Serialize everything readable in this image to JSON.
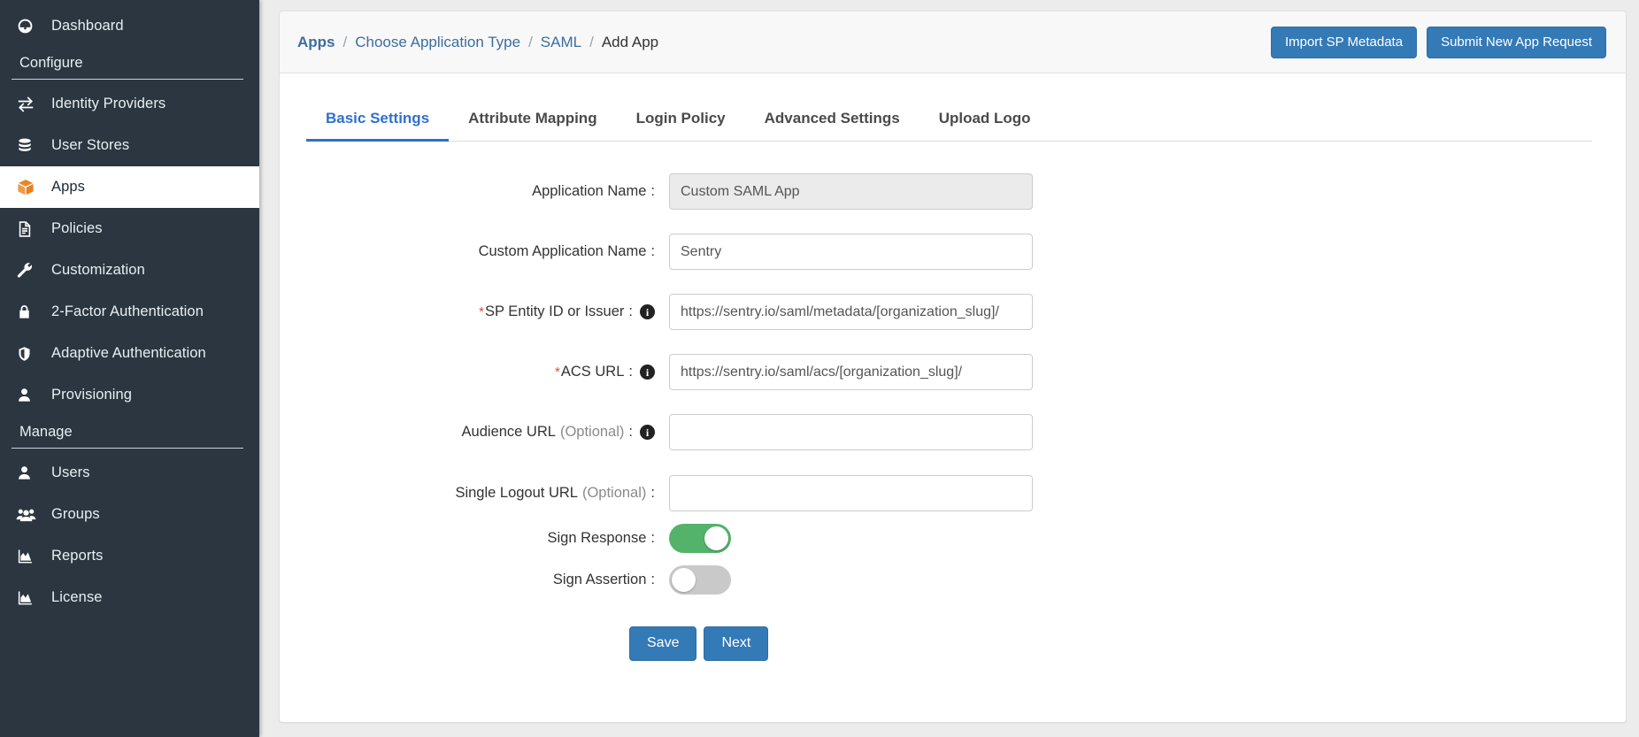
{
  "sidebar": {
    "groups": [
      {
        "type": "items",
        "items": [
          {
            "label": "Dashboard",
            "icon": "dashboard-gauge-icon",
            "active": false
          }
        ]
      },
      {
        "type": "section",
        "title": "Configure",
        "items": [
          {
            "label": "Identity Providers",
            "icon": "exchange-arrows-icon",
            "active": false
          },
          {
            "label": "User Stores",
            "icon": "database-icon",
            "active": false
          },
          {
            "label": "Apps",
            "icon": "box-icon",
            "active": true
          },
          {
            "label": "Policies",
            "icon": "document-icon",
            "active": false
          },
          {
            "label": "Customization",
            "icon": "wrench-icon",
            "active": false
          },
          {
            "label": "2-Factor Authentication",
            "icon": "lock-icon",
            "active": false
          },
          {
            "label": "Adaptive Authentication",
            "icon": "shield-icon",
            "active": false
          },
          {
            "label": "Provisioning",
            "icon": "user-icon",
            "active": false
          }
        ]
      },
      {
        "type": "section",
        "title": "Manage",
        "items": [
          {
            "label": "Users",
            "icon": "user-icon",
            "active": false
          },
          {
            "label": "Groups",
            "icon": "users-group-icon",
            "active": false
          },
          {
            "label": "Reports",
            "icon": "chart-area-icon",
            "active": false
          },
          {
            "label": "License",
            "icon": "chart-area-icon",
            "active": false
          }
        ]
      }
    ]
  },
  "header": {
    "breadcrumb": [
      {
        "label": "Apps",
        "link": true,
        "current": false
      },
      {
        "label": "Choose Application Type",
        "link": true,
        "current": false
      },
      {
        "label": "SAML",
        "link": true,
        "current": false
      },
      {
        "label": "Add App",
        "link": false,
        "current": true
      }
    ],
    "separator": "/",
    "actions": {
      "import_sp_metadata": "Import SP Metadata",
      "submit_new_app_request": "Submit New App Request"
    }
  },
  "tabs": [
    {
      "label": "Basic Settings",
      "active": true
    },
    {
      "label": "Attribute Mapping",
      "active": false
    },
    {
      "label": "Login Policy",
      "active": false
    },
    {
      "label": "Advanced Settings",
      "active": false
    },
    {
      "label": "Upload Logo",
      "active": false
    }
  ],
  "form": {
    "fields": [
      {
        "name": "application-name",
        "label": "Application Name",
        "required": false,
        "optional": false,
        "info": false,
        "value": "Custom SAML App",
        "placeholder": "",
        "readonly": true,
        "type": "text"
      },
      {
        "name": "custom-application-name",
        "label": "Custom Application Name",
        "required": false,
        "optional": false,
        "info": false,
        "value": "Sentry",
        "placeholder": "",
        "readonly": false,
        "type": "text"
      },
      {
        "name": "sp-entity-id",
        "label": "SP Entity ID or Issuer",
        "required": true,
        "optional": false,
        "info": true,
        "value": "https://sentry.io/saml/metadata/[organization_slug]/",
        "placeholder": "",
        "readonly": false,
        "type": "text"
      },
      {
        "name": "acs-url",
        "label": "ACS URL",
        "required": true,
        "optional": false,
        "info": true,
        "value": "https://sentry.io/saml/acs/[organization_slug]/",
        "placeholder": "",
        "readonly": false,
        "type": "text"
      },
      {
        "name": "audience-url",
        "label": "Audience URL",
        "required": false,
        "optional": true,
        "optional_text": "(Optional)",
        "info": true,
        "value": "",
        "placeholder": "",
        "readonly": false,
        "type": "text"
      },
      {
        "name": "single-logout-url",
        "label": "Single Logout URL",
        "required": false,
        "optional": true,
        "optional_text": "(Optional)",
        "info": false,
        "value": "",
        "placeholder": "",
        "readonly": false,
        "type": "text"
      },
      {
        "name": "sign-response",
        "label": "Sign Response",
        "required": false,
        "optional": false,
        "info": false,
        "type": "toggle",
        "checked": true
      },
      {
        "name": "sign-assertion",
        "label": "Sign Assertion",
        "required": false,
        "optional": false,
        "info": false,
        "type": "toggle",
        "checked": false
      }
    ],
    "colon": ":",
    "required_marker": "*",
    "info_glyph": "i",
    "buttons": {
      "save": "Save",
      "next": "Next"
    }
  },
  "colors": {
    "sidebar_bg": "#2b3641",
    "accent_blue": "#337ab7",
    "tab_active": "#2f6fd0",
    "breadcrumb_link": "#3b6e9f",
    "apps_icon_orange": "#e8801f",
    "toggle_on_green": "#53b36b",
    "toggle_off_gray": "#c9c9c9",
    "required_red": "#e24a3b",
    "page_bg": "#ececec"
  }
}
